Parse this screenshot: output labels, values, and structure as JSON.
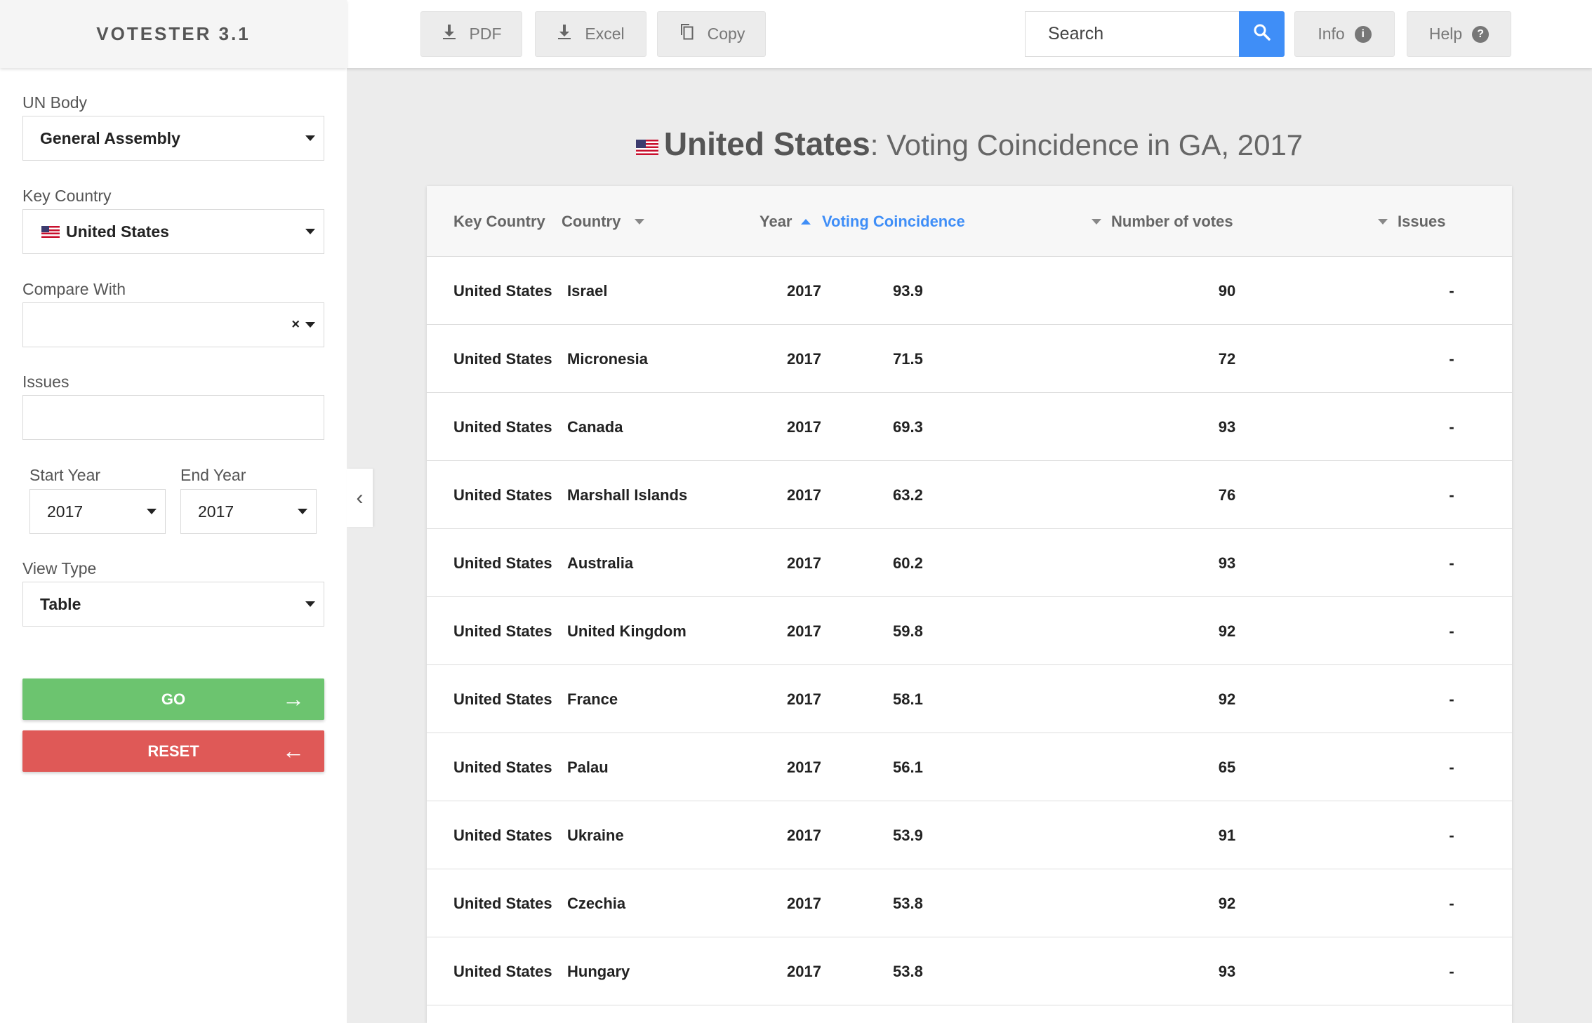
{
  "app": {
    "title": "VOTESTER 3.1"
  },
  "sidebar": {
    "un_body": {
      "label": "UN Body",
      "value": "General Assembly"
    },
    "key_country": {
      "label": "Key Country",
      "value": "United States"
    },
    "compare_with": {
      "label": "Compare With",
      "value": "",
      "clear": "×"
    },
    "issues": {
      "label": "Issues",
      "value": ""
    },
    "start_year": {
      "label": "Start Year",
      "value": "2017"
    },
    "end_year": {
      "label": "End Year",
      "value": "2017"
    },
    "view_type": {
      "label": "View Type",
      "value": "Table"
    },
    "go_label": "GO",
    "reset_label": "RESET"
  },
  "toolbar": {
    "pdf_label": "PDF",
    "excel_label": "Excel",
    "copy_label": "Copy",
    "search_placeholder": "Search",
    "info_label": "Info",
    "help_label": "Help"
  },
  "main": {
    "title_country": "United States",
    "title_rest": ": Voting Coincidence in GA, 2017"
  },
  "table": {
    "headers": {
      "key_country": "Key Country",
      "country": "Country",
      "year": "Year",
      "coincidence": "Voting Coincidence",
      "votes": "Number of votes",
      "issues": "Issues"
    },
    "rows": [
      {
        "key_country": "United States",
        "country": "Israel",
        "year": "2017",
        "coincidence": "93.9",
        "votes": "90",
        "issues": "-"
      },
      {
        "key_country": "United States",
        "country": "Micronesia",
        "year": "2017",
        "coincidence": "71.5",
        "votes": "72",
        "issues": "-"
      },
      {
        "key_country": "United States",
        "country": "Canada",
        "year": "2017",
        "coincidence": "69.3",
        "votes": "93",
        "issues": "-"
      },
      {
        "key_country": "United States",
        "country": "Marshall Islands",
        "year": "2017",
        "coincidence": "63.2",
        "votes": "76",
        "issues": "-"
      },
      {
        "key_country": "United States",
        "country": "Australia",
        "year": "2017",
        "coincidence": "60.2",
        "votes": "93",
        "issues": "-"
      },
      {
        "key_country": "United States",
        "country": "United Kingdom",
        "year": "2017",
        "coincidence": "59.8",
        "votes": "92",
        "issues": "-"
      },
      {
        "key_country": "United States",
        "country": "France",
        "year": "2017",
        "coincidence": "58.1",
        "votes": "92",
        "issues": "-"
      },
      {
        "key_country": "United States",
        "country": "Palau",
        "year": "2017",
        "coincidence": "56.1",
        "votes": "65",
        "issues": "-"
      },
      {
        "key_country": "United States",
        "country": "Ukraine",
        "year": "2017",
        "coincidence": "53.9",
        "votes": "91",
        "issues": "-"
      },
      {
        "key_country": "United States",
        "country": "Czechia",
        "year": "2017",
        "coincidence": "53.8",
        "votes": "92",
        "issues": "-"
      },
      {
        "key_country": "United States",
        "country": "Hungary",
        "year": "2017",
        "coincidence": "53.8",
        "votes": "93",
        "issues": "-"
      }
    ]
  },
  "colors": {
    "accent": "#3f8ef7",
    "go": "#6cc46f",
    "reset": "#df5957"
  }
}
